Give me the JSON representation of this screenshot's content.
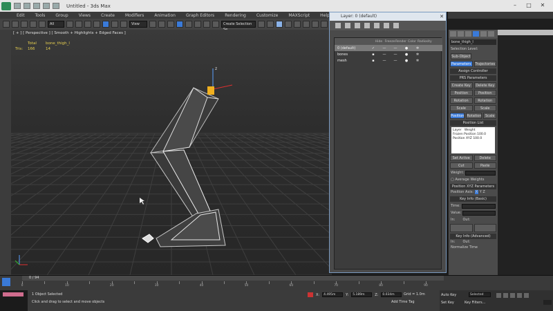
{
  "window": {
    "title": "Untitled - 3ds Max",
    "menu": [
      "Edit",
      "Tools",
      "Group",
      "Views",
      "Create",
      "Modifiers",
      "Animation",
      "Graph Editors",
      "Rendering",
      "Customize",
      "MAXScript",
      "Help"
    ],
    "toolbar_select": "All",
    "toolbar_view": "View",
    "named_selection": "Create Selection Se"
  },
  "viewport": {
    "label": "[ + ] [ Perspective ] [ Smooth + Highlights + Edged Faces ]",
    "stats_col_total": "Total",
    "stats_col_obj": "bone_thigh_l",
    "stats_row_label": "Tris:",
    "stats_total": "166",
    "stats_obj": "14"
  },
  "dialog": {
    "title": "Layer: 0 (default)",
    "headers": [
      "Hide",
      "Freeze",
      "Render",
      "Color",
      "Radiosity"
    ],
    "layers": [
      {
        "name": "0 (default)",
        "selected": true
      },
      {
        "name": "bones",
        "selected": false
      },
      {
        "name": "mesh",
        "selected": false
      }
    ]
  },
  "panel": {
    "object_name": "bone_thigh_l",
    "selection_level": "Selection Level:",
    "sub_object": "Sub-Object",
    "tab_parameters": "Parameters",
    "tab_trajectories": "Trajectories",
    "assign_controller": "Assign Controller",
    "prs_parameters": "PRS Parameters",
    "create_key": "Create Key",
    "delete_key": "Delete Key",
    "position": "Position",
    "rotation": "Rotation",
    "scale": "Scale",
    "position_list": "Position List",
    "list_layer": "Layer",
    "list_weight": "Weight",
    "list_frozen": "Frozen Position",
    "list_frozen_val": "100.0",
    "list_xyz": "Position XYZ",
    "list_xyz_val": "100.0",
    "set_active": "Set Active",
    "delete": "Delete",
    "cut": "Cut",
    "paste": "Paste",
    "weight_label": "Weight:",
    "average_weights": "Average Weights",
    "position_xyz_params": "Position XYZ Parameters",
    "position_axis": "Position Axis:",
    "axis_x": "X",
    "axis_y": "Y",
    "axis_z": "Z",
    "key_info_basic": "Key Info (Basic)",
    "time": "Time:",
    "value": "Value:",
    "in": "In:",
    "out": "Out:",
    "key_info_advanced": "Key Info (Advanced)",
    "normalize_time": "Normalize Time"
  },
  "timeline": {
    "frame": "0 / 94",
    "ticks": [
      "0",
      "10",
      "20",
      "30",
      "40",
      "50",
      "60",
      "70",
      "80",
      "90"
    ]
  },
  "status": {
    "selected": "1 Object Selected",
    "prompt": "Click and drag to select and move objects",
    "x": "4.495m",
    "y": "5.189m",
    "z": "0.034m",
    "grid": "Grid = 1.0m",
    "add_time_tag": "Add Time Tag",
    "auto_key": "Auto Key",
    "selected_mode": "Selected",
    "set_key": "Set Key",
    "key_filters": "Key Filters..."
  }
}
